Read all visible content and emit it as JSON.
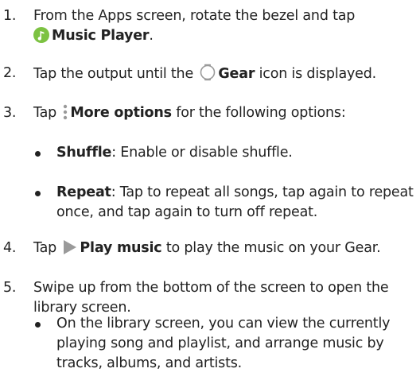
{
  "steps": [
    {
      "num": "1.",
      "t1": "From the Apps screen, rotate the bezel and tap",
      "b1": "Music Player",
      "t2": "."
    },
    {
      "num": "2.",
      "t1": "Tap the output until the",
      "b1": "Gear",
      "t2": "icon is displayed."
    },
    {
      "num": "3.",
      "t1": "Tap",
      "b1": "More options",
      "t2": "for the following options:",
      "subs": [
        {
          "b": "Shuffle",
          "t": ": Enable or disable shuffle."
        },
        {
          "b": "Repeat",
          "t": ": Tap to repeat all songs, tap again to repeat once, and tap again to turn off repeat."
        }
      ]
    },
    {
      "num": "4.",
      "t1": "Tap",
      "b1": "Play music",
      "t2": "to play the music on your Gear."
    },
    {
      "num": "5.",
      "t1": "Swipe up from the bottom of the screen to open the library screen.",
      "subs": [
        {
          "t": "On the library screen, you can view the currently playing song and playlist, and arrange music by tracks, albums, and artists."
        }
      ]
    }
  ],
  "colors": {
    "music_icon": "#7cc242",
    "play_icon": "#9a9a9a",
    "text": "#222222"
  }
}
